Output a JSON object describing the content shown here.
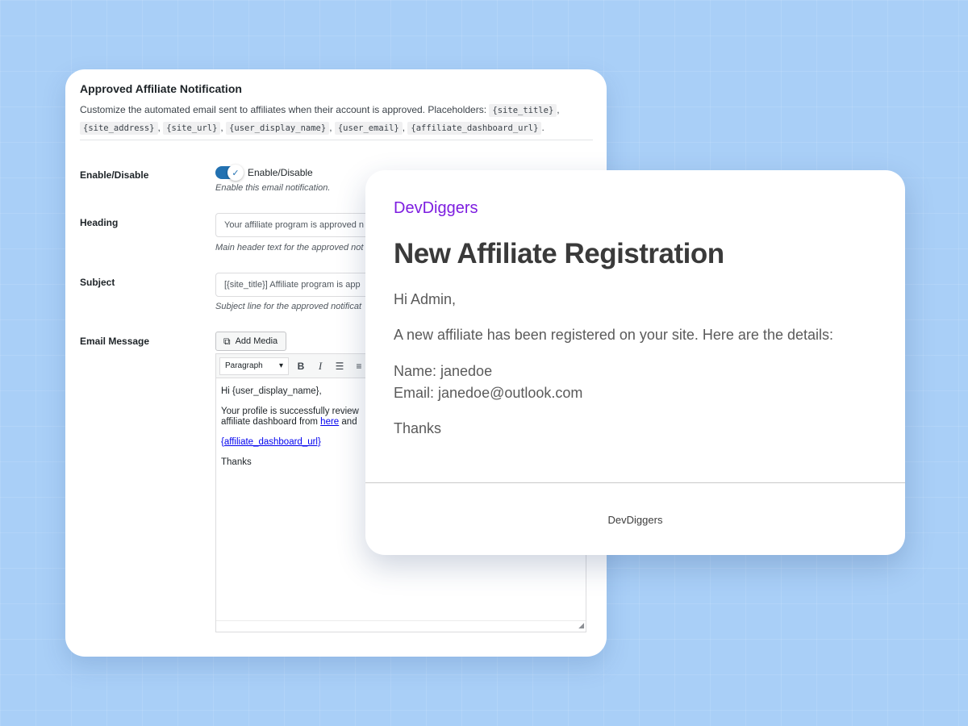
{
  "settings": {
    "title": "Approved Affiliate Notification",
    "description_prefix": "Customize the automated email sent to affiliates when their account is approved. Placeholders:",
    "placeholders": [
      "{site_title}",
      "{site_address}",
      "{site_url}",
      "{user_display_name}",
      "{user_email}",
      "{affiliate_dashboard_url}"
    ],
    "description_suffix": ".",
    "enable": {
      "label": "Enable/Disable",
      "toggle_label": "Enable/Disable",
      "help": "Enable this email notification.",
      "checked": true
    },
    "heading": {
      "label": "Heading",
      "value": "Your affiliate program is approved n",
      "help": "Main header text for the approved not"
    },
    "subject": {
      "label": "Subject",
      "value": "[{site_title}] Affiliate program is app",
      "help": "Subject line for the approved notificat"
    },
    "message": {
      "label": "Email Message",
      "add_media": "Add Media",
      "format": "Paragraph",
      "body_greeting": "Hi {user_display_name},",
      "body_line1": "Your profile is successfully review",
      "body_line2_prefix": "affiliate dashboard from ",
      "body_line2_link": "here",
      "body_line2_suffix": " and",
      "dashboard_link": "{affiliate_dashboard_url}",
      "closing": "Thanks"
    }
  },
  "email": {
    "brand": "DevDiggers",
    "heading": "New Affiliate Registration",
    "greeting": "Hi Admin,",
    "intro": "A new affiliate has been registered on your site. Here are the details:",
    "name_line": "Name: janedoe",
    "email_line": "Email: janedoe@outlook.com",
    "closing": "Thanks",
    "footer": "DevDiggers"
  },
  "colors": {
    "background": "#a9cff7",
    "toggle_on": "#2271b1",
    "brand": "#7d1de0",
    "link": "#0000ee"
  }
}
